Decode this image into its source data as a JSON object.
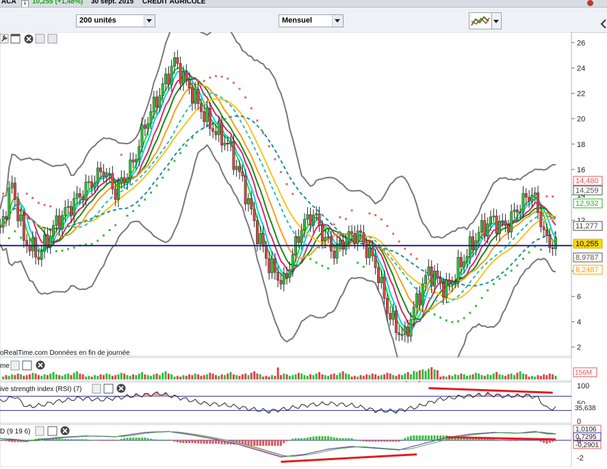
{
  "header": {
    "ticker": "ACA",
    "price_change": "10,255 (+1,48%)",
    "date": "30 sept. 2015",
    "name": "CREDIT AGRICOLE"
  },
  "toolbar": {
    "units_label": "200 unités",
    "period_label": "Mensuel"
  },
  "chart_data": [
    {
      "type": "candlestick",
      "title": "",
      "source_note": "oRealTime.com  Données en fin de journée",
      "y_ticks": [
        "2",
        "4",
        "6",
        "8",
        "10",
        "12",
        "14",
        "16",
        "18",
        "20",
        "22",
        "24",
        "26"
      ],
      "ylim": [
        1.5,
        26.5
      ],
      "horizontal_line": 10.0,
      "price_labels": [
        {
          "text": "14,480",
          "color": "#e05555"
        },
        {
          "text": "14,259",
          "color": "#555555"
        },
        {
          "text": "12,932",
          "color": "#22bb22"
        },
        {
          "text": "11,277",
          "color": "#444444"
        },
        {
          "text": "10,255",
          "color": "#ffd700"
        },
        {
          "text": "8,9787",
          "color": "#555555"
        },
        {
          "text": "8,2487",
          "color": "#ff9900"
        }
      ],
      "price_path": [
        [
          1,
          11.2
        ],
        [
          5,
          14.8
        ],
        [
          9,
          10.5
        ],
        [
          14,
          9.2
        ],
        [
          20,
          11.8
        ],
        [
          30,
          14.5
        ],
        [
          36,
          16
        ],
        [
          40,
          14.2
        ],
        [
          46,
          16.5
        ],
        [
          50,
          19.5
        ],
        [
          55,
          22
        ],
        [
          60,
          24.5
        ],
        [
          66,
          22
        ],
        [
          72,
          19.5
        ],
        [
          78,
          18
        ],
        [
          83,
          15
        ],
        [
          88,
          11
        ],
        [
          92,
          8.5
        ],
        [
          97,
          7
        ],
        [
          103,
          11.5
        ],
        [
          107,
          12.5
        ],
        [
          111,
          10.5
        ],
        [
          114,
          9.5
        ],
        [
          118,
          10.5
        ],
        [
          122,
          11
        ],
        [
          128,
          8.5
        ],
        [
          132,
          5
        ],
        [
          135,
          3.5
        ],
        [
          138,
          2.8
        ],
        [
          141,
          5
        ],
        [
          146,
          8
        ],
        [
          152,
          6.5
        ],
        [
          158,
          9
        ],
        [
          163,
          11
        ],
        [
          167,
          12
        ],
        [
          172,
          11.5
        ],
        [
          177,
          13.2
        ],
        [
          181,
          14.2
        ],
        [
          184,
          12
        ],
        [
          186,
          10.2
        ]
      ],
      "series": [
        {
          "name": "",
          "color": "#22dd22",
          "role": "ma-fast"
        },
        {
          "name": "",
          "color": "#00d0f0",
          "role": "ma"
        },
        {
          "name": "",
          "color": "#e0206a",
          "role": "ma"
        },
        {
          "name": "",
          "color": "#138a13",
          "role": "ma"
        },
        {
          "name": "",
          "color": "#ff9a1a",
          "role": "ma"
        },
        {
          "name": "",
          "color": "#ffc21a",
          "role": "ma-slow"
        },
        {
          "name": "",
          "color": "#22bfbf",
          "role": "ma-dashed"
        },
        {
          "name": "",
          "color": "#1e8aa0",
          "role": "ma-dashed-long"
        },
        {
          "name": "",
          "color": "#777777",
          "role": "bollinger"
        },
        {
          "name": "",
          "color": "#e05555",
          "role": "sar"
        }
      ]
    },
    {
      "type": "bar",
      "title": "me",
      "value_label": "156M",
      "volume_pattern": [
        2,
        3,
        2,
        4,
        3,
        5,
        4,
        6,
        5,
        3,
        4,
        5,
        7,
        6,
        4,
        3,
        5,
        4,
        6,
        8,
        5,
        4,
        3,
        5,
        6,
        4,
        7,
        9,
        6,
        5
      ]
    },
    {
      "type": "line",
      "title": "ive strength index (RSI) (7)",
      "y_ticks": [
        "0",
        "50",
        "100"
      ],
      "levels": [
        30,
        70
      ],
      "value_label": "35,638",
      "ylim": [
        0,
        100
      ],
      "rsi_path": [
        [
          1,
          55
        ],
        [
          6,
          70
        ],
        [
          10,
          40
        ],
        [
          15,
          45
        ],
        [
          20,
          55
        ],
        [
          28,
          65
        ],
        [
          35,
          60
        ],
        [
          45,
          70
        ],
        [
          55,
          78
        ],
        [
          62,
          65
        ],
        [
          70,
          50
        ],
        [
          78,
          45
        ],
        [
          85,
          35
        ],
        [
          92,
          28
        ],
        [
          98,
          35
        ],
        [
          105,
          45
        ],
        [
          112,
          50
        ],
        [
          120,
          45
        ],
        [
          128,
          30
        ],
        [
          135,
          28
        ],
        [
          142,
          40
        ],
        [
          150,
          62
        ],
        [
          158,
          70
        ],
        [
          166,
          75
        ],
        [
          172,
          70
        ],
        [
          180,
          72
        ],
        [
          183,
          65
        ],
        [
          186,
          36
        ]
      ]
    },
    {
      "type": "line",
      "title": "D (9 19 6)",
      "value_labels": [
        "1,0106",
        "0,7295",
        "-0,2901"
      ],
      "y_ticks": [
        "0",
        "-2"
      ],
      "ylim": [
        -2.8,
        1.4
      ],
      "macd_path": [
        [
          1,
          0.2
        ],
        [
          10,
          -0.1
        ],
        [
          20,
          0.3
        ],
        [
          30,
          0.5
        ],
        [
          40,
          0.4
        ],
        [
          50,
          0.9
        ],
        [
          58,
          1.0
        ],
        [
          66,
          0.6
        ],
        [
          74,
          0.1
        ],
        [
          82,
          -0.5
        ],
        [
          90,
          -1.3
        ],
        [
          96,
          -1.9
        ],
        [
          104,
          -1.6
        ],
        [
          112,
          -1.0
        ],
        [
          120,
          -0.7
        ],
        [
          128,
          -0.9
        ],
        [
          136,
          -1.1
        ],
        [
          144,
          -0.4
        ],
        [
          152,
          0.3
        ],
        [
          160,
          0.7
        ],
        [
          168,
          0.9
        ],
        [
          176,
          0.8
        ],
        [
          182,
          1.0
        ],
        [
          186,
          0.73
        ]
      ],
      "trendlines": [
        "divergence-low",
        "divergence-high"
      ]
    }
  ]
}
